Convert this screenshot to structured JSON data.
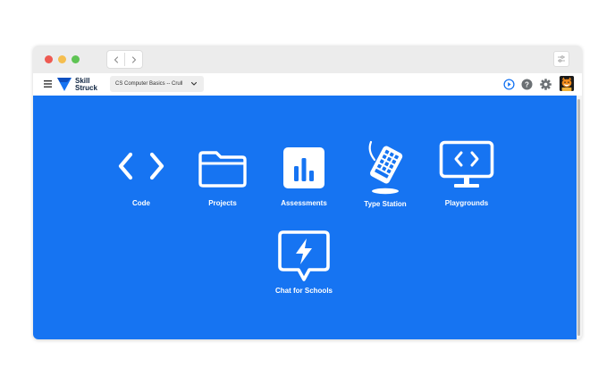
{
  "browser": {
    "traffic_lights": {
      "close": "#ee5a52",
      "minimize": "#f5be4f",
      "zoom": "#5fc454"
    },
    "nav": {
      "back_icon": "chevron-left-icon",
      "forward_icon": "chevron-right-icon"
    },
    "settings_icon": "sliders-icon"
  },
  "app": {
    "logo": {
      "line1": "Skill",
      "line2": "Struck",
      "color": "#1674f2"
    },
    "course_selector": {
      "value": "CS Computer Basics -- Crull"
    },
    "header_icons": [
      "play-icon",
      "help-icon",
      "gear-icon",
      "avatar-fox"
    ]
  },
  "main": {
    "background": "#1674f2",
    "tiles": [
      {
        "label": "Code",
        "icon": "code-brackets-icon"
      },
      {
        "label": "Projects",
        "icon": "folder-icon"
      },
      {
        "label": "Assessments",
        "icon": "bar-chart-icon"
      },
      {
        "label": "Type Station",
        "icon": "keyboard-icon"
      },
      {
        "label": "Playgrounds",
        "icon": "monitor-code-icon"
      },
      {
        "label": "Chat for Schools",
        "icon": "chat-lightning-icon"
      }
    ]
  }
}
